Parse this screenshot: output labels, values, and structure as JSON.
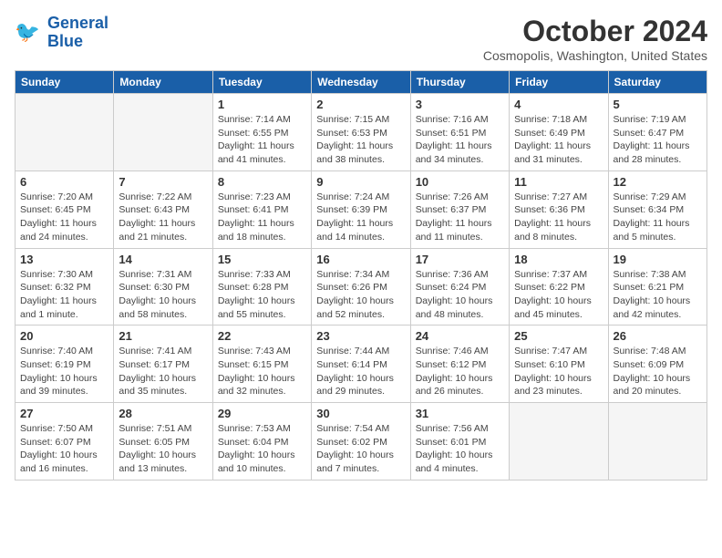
{
  "header": {
    "logo_line1": "General",
    "logo_line2": "Blue",
    "month_title": "October 2024",
    "location": "Cosmopolis, Washington, United States"
  },
  "days_of_week": [
    "Sunday",
    "Monday",
    "Tuesday",
    "Wednesday",
    "Thursday",
    "Friday",
    "Saturday"
  ],
  "weeks": [
    [
      {
        "day": "",
        "sunrise": "",
        "sunset": "",
        "daylight": ""
      },
      {
        "day": "",
        "sunrise": "",
        "sunset": "",
        "daylight": ""
      },
      {
        "day": "1",
        "sunrise": "Sunrise: 7:14 AM",
        "sunset": "Sunset: 6:55 PM",
        "daylight": "Daylight: 11 hours and 41 minutes."
      },
      {
        "day": "2",
        "sunrise": "Sunrise: 7:15 AM",
        "sunset": "Sunset: 6:53 PM",
        "daylight": "Daylight: 11 hours and 38 minutes."
      },
      {
        "day": "3",
        "sunrise": "Sunrise: 7:16 AM",
        "sunset": "Sunset: 6:51 PM",
        "daylight": "Daylight: 11 hours and 34 minutes."
      },
      {
        "day": "4",
        "sunrise": "Sunrise: 7:18 AM",
        "sunset": "Sunset: 6:49 PM",
        "daylight": "Daylight: 11 hours and 31 minutes."
      },
      {
        "day": "5",
        "sunrise": "Sunrise: 7:19 AM",
        "sunset": "Sunset: 6:47 PM",
        "daylight": "Daylight: 11 hours and 28 minutes."
      }
    ],
    [
      {
        "day": "6",
        "sunrise": "Sunrise: 7:20 AM",
        "sunset": "Sunset: 6:45 PM",
        "daylight": "Daylight: 11 hours and 24 minutes."
      },
      {
        "day": "7",
        "sunrise": "Sunrise: 7:22 AM",
        "sunset": "Sunset: 6:43 PM",
        "daylight": "Daylight: 11 hours and 21 minutes."
      },
      {
        "day": "8",
        "sunrise": "Sunrise: 7:23 AM",
        "sunset": "Sunset: 6:41 PM",
        "daylight": "Daylight: 11 hours and 18 minutes."
      },
      {
        "day": "9",
        "sunrise": "Sunrise: 7:24 AM",
        "sunset": "Sunset: 6:39 PM",
        "daylight": "Daylight: 11 hours and 14 minutes."
      },
      {
        "day": "10",
        "sunrise": "Sunrise: 7:26 AM",
        "sunset": "Sunset: 6:37 PM",
        "daylight": "Daylight: 11 hours and 11 minutes."
      },
      {
        "day": "11",
        "sunrise": "Sunrise: 7:27 AM",
        "sunset": "Sunset: 6:36 PM",
        "daylight": "Daylight: 11 hours and 8 minutes."
      },
      {
        "day": "12",
        "sunrise": "Sunrise: 7:29 AM",
        "sunset": "Sunset: 6:34 PM",
        "daylight": "Daylight: 11 hours and 5 minutes."
      }
    ],
    [
      {
        "day": "13",
        "sunrise": "Sunrise: 7:30 AM",
        "sunset": "Sunset: 6:32 PM",
        "daylight": "Daylight: 11 hours and 1 minute."
      },
      {
        "day": "14",
        "sunrise": "Sunrise: 7:31 AM",
        "sunset": "Sunset: 6:30 PM",
        "daylight": "Daylight: 10 hours and 58 minutes."
      },
      {
        "day": "15",
        "sunrise": "Sunrise: 7:33 AM",
        "sunset": "Sunset: 6:28 PM",
        "daylight": "Daylight: 10 hours and 55 minutes."
      },
      {
        "day": "16",
        "sunrise": "Sunrise: 7:34 AM",
        "sunset": "Sunset: 6:26 PM",
        "daylight": "Daylight: 10 hours and 52 minutes."
      },
      {
        "day": "17",
        "sunrise": "Sunrise: 7:36 AM",
        "sunset": "Sunset: 6:24 PM",
        "daylight": "Daylight: 10 hours and 48 minutes."
      },
      {
        "day": "18",
        "sunrise": "Sunrise: 7:37 AM",
        "sunset": "Sunset: 6:22 PM",
        "daylight": "Daylight: 10 hours and 45 minutes."
      },
      {
        "day": "19",
        "sunrise": "Sunrise: 7:38 AM",
        "sunset": "Sunset: 6:21 PM",
        "daylight": "Daylight: 10 hours and 42 minutes."
      }
    ],
    [
      {
        "day": "20",
        "sunrise": "Sunrise: 7:40 AM",
        "sunset": "Sunset: 6:19 PM",
        "daylight": "Daylight: 10 hours and 39 minutes."
      },
      {
        "day": "21",
        "sunrise": "Sunrise: 7:41 AM",
        "sunset": "Sunset: 6:17 PM",
        "daylight": "Daylight: 10 hours and 35 minutes."
      },
      {
        "day": "22",
        "sunrise": "Sunrise: 7:43 AM",
        "sunset": "Sunset: 6:15 PM",
        "daylight": "Daylight: 10 hours and 32 minutes."
      },
      {
        "day": "23",
        "sunrise": "Sunrise: 7:44 AM",
        "sunset": "Sunset: 6:14 PM",
        "daylight": "Daylight: 10 hours and 29 minutes."
      },
      {
        "day": "24",
        "sunrise": "Sunrise: 7:46 AM",
        "sunset": "Sunset: 6:12 PM",
        "daylight": "Daylight: 10 hours and 26 minutes."
      },
      {
        "day": "25",
        "sunrise": "Sunrise: 7:47 AM",
        "sunset": "Sunset: 6:10 PM",
        "daylight": "Daylight: 10 hours and 23 minutes."
      },
      {
        "day": "26",
        "sunrise": "Sunrise: 7:48 AM",
        "sunset": "Sunset: 6:09 PM",
        "daylight": "Daylight: 10 hours and 20 minutes."
      }
    ],
    [
      {
        "day": "27",
        "sunrise": "Sunrise: 7:50 AM",
        "sunset": "Sunset: 6:07 PM",
        "daylight": "Daylight: 10 hours and 16 minutes."
      },
      {
        "day": "28",
        "sunrise": "Sunrise: 7:51 AM",
        "sunset": "Sunset: 6:05 PM",
        "daylight": "Daylight: 10 hours and 13 minutes."
      },
      {
        "day": "29",
        "sunrise": "Sunrise: 7:53 AM",
        "sunset": "Sunset: 6:04 PM",
        "daylight": "Daylight: 10 hours and 10 minutes."
      },
      {
        "day": "30",
        "sunrise": "Sunrise: 7:54 AM",
        "sunset": "Sunset: 6:02 PM",
        "daylight": "Daylight: 10 hours and 7 minutes."
      },
      {
        "day": "31",
        "sunrise": "Sunrise: 7:56 AM",
        "sunset": "Sunset: 6:01 PM",
        "daylight": "Daylight: 10 hours and 4 minutes."
      },
      {
        "day": "",
        "sunrise": "",
        "sunset": "",
        "daylight": ""
      },
      {
        "day": "",
        "sunrise": "",
        "sunset": "",
        "daylight": ""
      }
    ]
  ]
}
